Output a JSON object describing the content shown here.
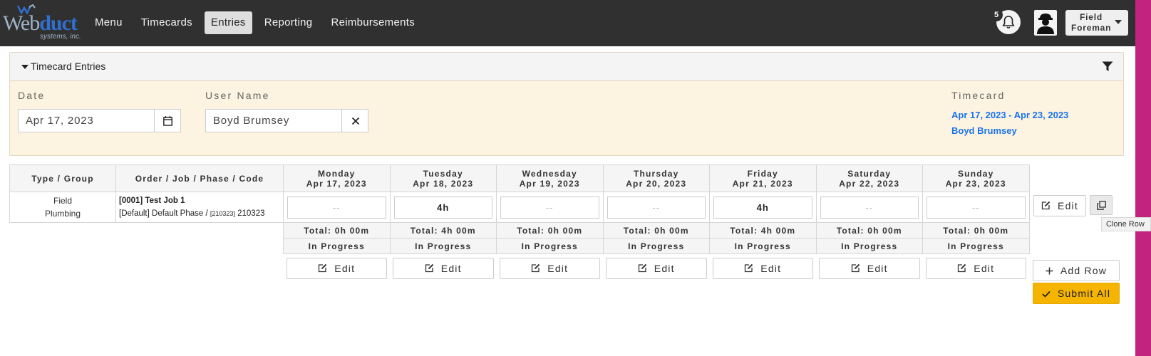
{
  "brand": {
    "logo_word1": "Web",
    "logo_word2": "duct",
    "logo_sub": "systems, inc."
  },
  "nav": {
    "items": [
      {
        "label": "Menu"
      },
      {
        "label": "Timecards"
      },
      {
        "label": "Entries",
        "active": true
      },
      {
        "label": "Reporting"
      },
      {
        "label": "Reimbursements"
      }
    ]
  },
  "header": {
    "notification_count": "5",
    "user_role": "Field Foreman"
  },
  "panel": {
    "title": "Timecard Entries",
    "date_label": "Date",
    "date_value": "Apr 17, 2023",
    "user_label": "User Name",
    "user_value": "Boyd Brumsey",
    "timecard_label": "Timecard",
    "timecard_range": "Apr 17, 2023 - Apr 23, 2023",
    "timecard_user": "Boyd Brumsey"
  },
  "table": {
    "col_type": "Type / Group",
    "col_job": "Order / Job / Phase / Code",
    "days": [
      {
        "day": "Monday",
        "date": "Apr 17, 2023",
        "hours": "--",
        "total": "Total: 0h 00m",
        "status": "In Progress"
      },
      {
        "day": "Tuesday",
        "date": "Apr 18, 2023",
        "hours": "4h",
        "total": "Total: 4h 00m",
        "status": "In Progress"
      },
      {
        "day": "Wednesday",
        "date": "Apr 19, 2023",
        "hours": "--",
        "total": "Total: 0h 00m",
        "status": "In Progress"
      },
      {
        "day": "Thursday",
        "date": "Apr 20, 2023",
        "hours": "--",
        "total": "Total: 0h 00m",
        "status": "In Progress"
      },
      {
        "day": "Friday",
        "date": "Apr 21, 2023",
        "hours": "4h",
        "total": "Total: 4h 00m",
        "status": "In Progress"
      },
      {
        "day": "Saturday",
        "date": "Apr 22, 2023",
        "hours": "--",
        "total": "Total: 0h 00m",
        "status": "In Progress"
      },
      {
        "day": "Sunday",
        "date": "Apr 23, 2023",
        "hours": "--",
        "total": "Total: 0h 00m",
        "status": "In Progress"
      }
    ],
    "row": {
      "type_line1": "Field",
      "type_line2": "Plumbing",
      "job_line1": "[0001] Test Job 1",
      "job_phase": "[Default] Default Phase /",
      "job_code_small": "[210323]",
      "job_code": "210323"
    },
    "edit_label": "Edit"
  },
  "actions": {
    "row_edit": "Edit",
    "clone_tooltip": "Clone Row",
    "add_row": "Add Row",
    "submit_all": "Submit All"
  }
}
